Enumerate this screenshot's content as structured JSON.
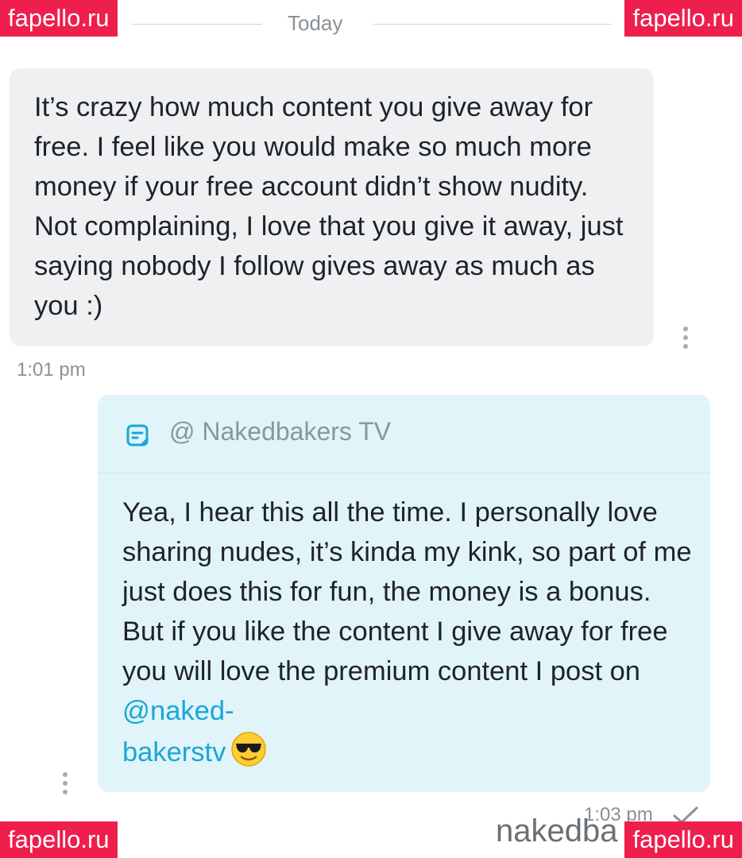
{
  "watermarks": {
    "top_left": "fapello.ru",
    "top_right": "fapello.ru",
    "bottom_left": "fapello.ru",
    "bottom_right": "fapello.ru",
    "brand": "nakedba"
  },
  "date_divider": "Today",
  "incoming_message": {
    "text": "It’s crazy how much content you give away for free. I feel like you would make so much more money if your free account didn’t show nudity. Not complaining, I love that you give it away, just saying nobody I follow gives away as much as you :)",
    "time": "1:01 pm"
  },
  "outgoing_message": {
    "handle": "@ Nakedbakers TV",
    "text": "Yea, I hear this all the time. I personally love sharing nudes, it’s kinda my kink, so part of me just does this for fun, the money is a bonus. But if you like the content I give away for free you will love the premium content I post on",
    "mention_part1": "@naked-",
    "mention_part2": "bakerstv",
    "time": "1:03 pm",
    "status_icon": "check-icon",
    "emoji_icon": "sunglasses-emoji-icon"
  },
  "colors": {
    "accent": "#1aa6d6",
    "incoming_bg": "#eef0f2",
    "outgoing_bg": "#e0f4fa",
    "watermark": "#ee1e4d"
  }
}
